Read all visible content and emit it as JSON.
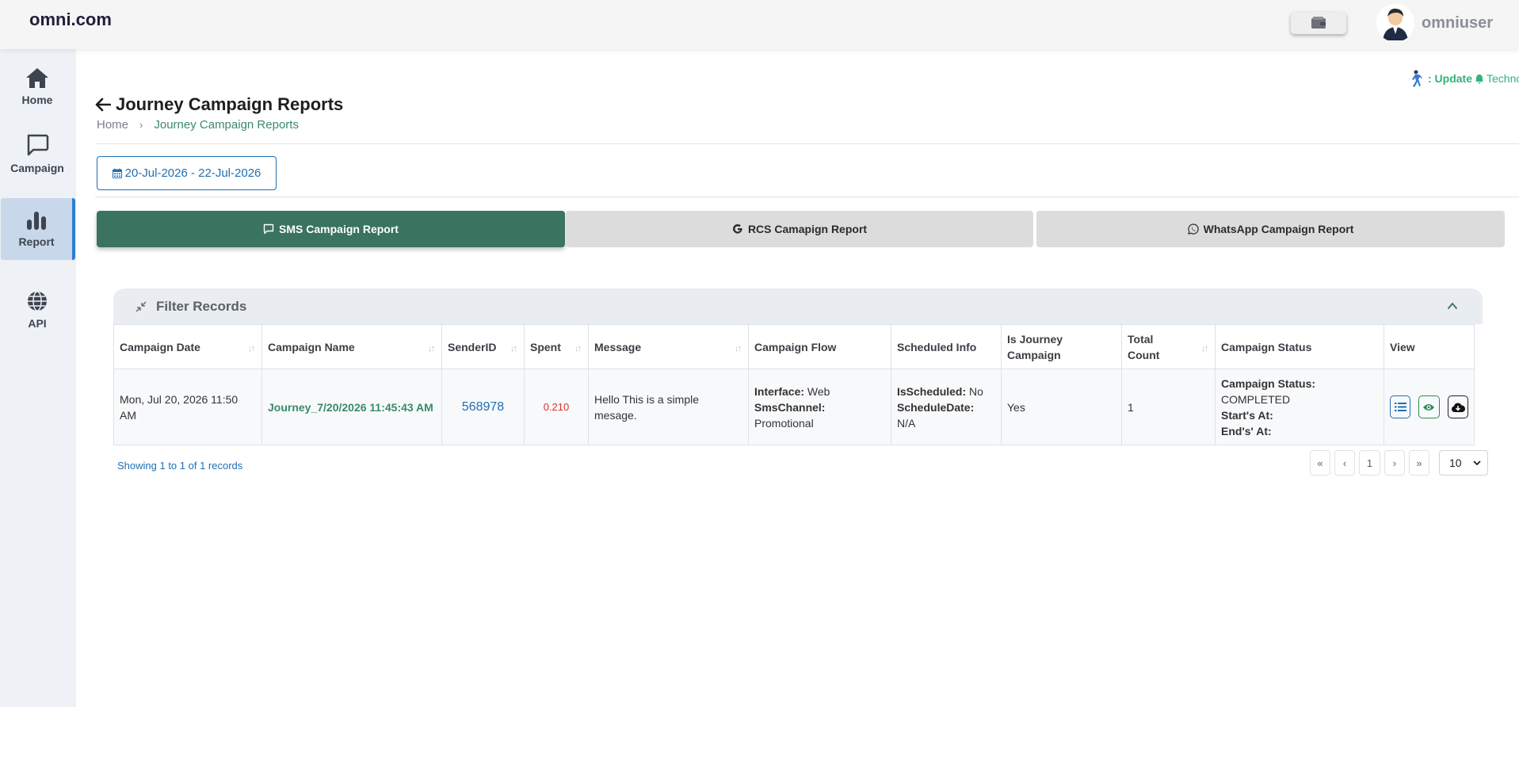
{
  "app": {
    "logo": "omni.com",
    "username": "omniuser"
  },
  "sidebar": {
    "items": [
      {
        "label": "Home",
        "icon": "home-icon"
      },
      {
        "label": "Campaign",
        "icon": "chat-bubble-icon"
      },
      {
        "label": "Report",
        "icon": "bar-chart-icon",
        "active": true
      },
      {
        "label": "API",
        "icon": "globe-icon"
      }
    ]
  },
  "ticker": {
    "update": ": Update",
    "tech": "Technology is"
  },
  "page": {
    "title": "Journey Campaign Reports"
  },
  "breadcrumb": {
    "home": "Home",
    "current": "Journey Campaign Reports"
  },
  "date_range": "20-Jul-2026 - 22-Jul-2026",
  "tabs": [
    {
      "label": "SMS Campaign Report",
      "active": true
    },
    {
      "label": "RCS Camapign Report",
      "active": false
    },
    {
      "label": "WhatsApp Campaign Report",
      "active": false
    }
  ],
  "filter": {
    "title": "Filter Records"
  },
  "table": {
    "headers": {
      "date": "Campaign Date",
      "name": "Campaign Name",
      "sender": "SenderID",
      "spent": "Spent",
      "message": "Message",
      "flow": "Campaign Flow",
      "scheduled": "Scheduled Info",
      "journey": "Is Journey Campaign",
      "total": "Total Count",
      "status": "Campaign Status",
      "view": "View"
    },
    "row": {
      "date": "Mon, Jul 20, 2026 11:50 AM",
      "name": "Journey_7/20/2026 11:45:43 AM",
      "sender": "568978",
      "spent": "0.210",
      "message": "Hello This is a simple mesage.",
      "interface_label": "Interface:",
      "interface_value": "Web",
      "channel_label": "SmsChannel:",
      "channel_value": "Promotional",
      "is_scheduled_label": "IsScheduled:",
      "is_scheduled_value": "No",
      "schedule_date_label": "ScheduleDate:",
      "schedule_date_value": "N/A",
      "journey": "Yes",
      "total": "1",
      "status_label": "Campaign Status:",
      "status_value": "COMPLETED",
      "start_label": "Start's At:",
      "end_label": "End's' At:"
    }
  },
  "pagination": {
    "showing": "Showing 1 to 1 of 1 records",
    "first": "«",
    "prev": "‹",
    "page": "1",
    "next": "›",
    "last": "»",
    "page_size": "10"
  },
  "colors": {
    "primary_green": "#3a7360",
    "link_blue": "#1f6fb5",
    "accent_green": "#2fb47a",
    "spent_red": "#e03030"
  }
}
